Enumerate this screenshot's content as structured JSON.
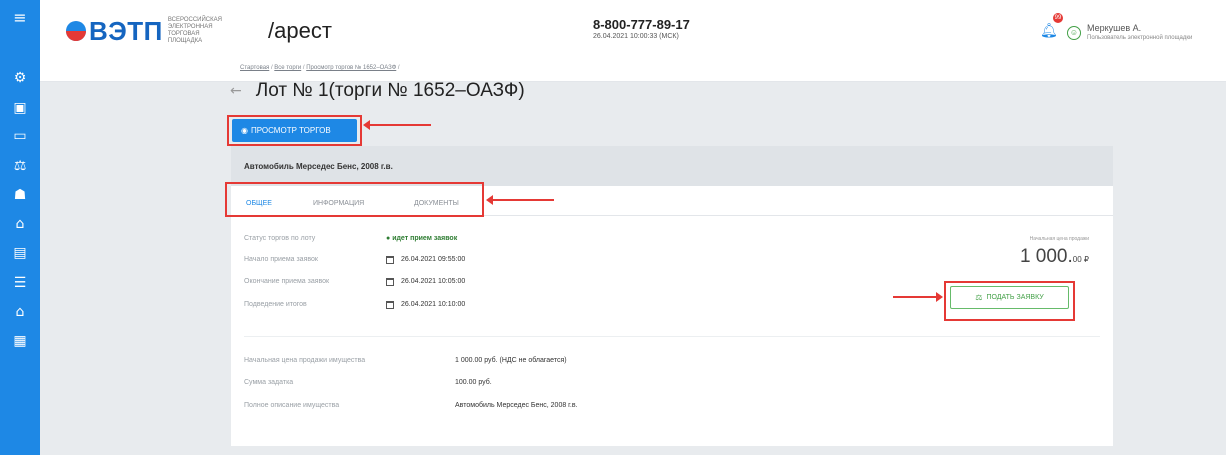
{
  "header": {
    "logo_text": "ВЭТП",
    "logo_subtitle": "Всероссийская электронная торговая площадка",
    "module": "/арест",
    "phone": "8-800-777-89-17",
    "datetime": "26.04.2021 10:00:33 (МСК)",
    "notifications_count": "99",
    "user_name": "Меркушев А.",
    "user_role": "Пользователь электронной площадки"
  },
  "sidebar": {
    "icons": [
      "menu-icon",
      "settings-icon",
      "document-icon",
      "card-icon",
      "auction-icon",
      "user-icon",
      "lot-icon",
      "file-icon",
      "list-icon",
      "home-icon",
      "calculator-icon"
    ]
  },
  "breadcrumb": {
    "home": "Стартовая",
    "all_auctions": "Все торги",
    "view_auction": "Просмотр торгов № 1652–ОАЗФ"
  },
  "page": {
    "title": "Лот № 1(торги № 1652–ОАЗФ)",
    "view_button": "ПРОСМОТР ТОРГОВ"
  },
  "lot": {
    "name": "Автомобиль Мерседес Бенс, 2008 г.в.",
    "tabs": [
      "ОБЩЕЕ",
      "ИНФОРМАЦИЯ",
      "ДОКУМЕНТЫ"
    ],
    "details": [
      {
        "label": "Статус торгов по лоту",
        "value": "идет прием заявок"
      },
      {
        "label": "Начало приема заявок",
        "value": "26.04.2021 09:55:00"
      },
      {
        "label": "Окончание приема заявок",
        "value": "26.04.2021 10:05:00"
      },
      {
        "label": "Подведение итогов",
        "value": "26.04.2021 10:10:00"
      }
    ],
    "price_label": "Начальная цена продажи",
    "price_main": "1 000.",
    "price_cents": "00 ₽",
    "apply_button": "ПОДАТЬ ЗАЯВКУ",
    "extra": [
      {
        "label": "Начальная цена продажи имущества",
        "value": "1 000.00 руб. (НДС не облагается)"
      },
      {
        "label": "Сумма задатка",
        "value": "100.00 руб."
      },
      {
        "label": "Полное описание имущества",
        "value": "Автомобиль Мерседес Бенс, 2008 г.в."
      }
    ]
  },
  "colors": {
    "primary": "#1e88e5",
    "highlight": "#e53935",
    "success": "#43a047"
  }
}
